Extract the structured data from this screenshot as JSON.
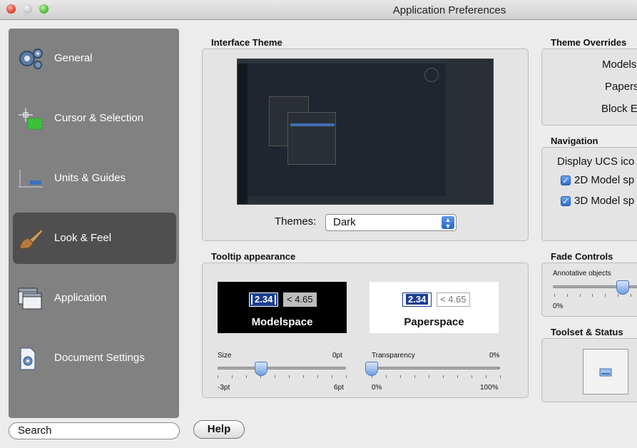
{
  "window": {
    "title": "Application Preferences"
  },
  "sidebar": {
    "items": [
      {
        "label": "General",
        "icon": "gear-icon"
      },
      {
        "label": "Cursor & Selection",
        "icon": "crosshair-cursor-icon"
      },
      {
        "label": "Units & Guides",
        "icon": "units-ruler-icon"
      },
      {
        "label": "Look & Feel",
        "icon": "paintbrush-icon",
        "selected": true
      },
      {
        "label": "Application",
        "icon": "application-windows-icon"
      },
      {
        "label": "Document Settings",
        "icon": "document-gear-icon"
      }
    ],
    "search_placeholder": "Search"
  },
  "help_label": "Help",
  "interface_theme": {
    "title": "Interface Theme",
    "themes_label": "Themes:",
    "selected": "Dark"
  },
  "tooltip": {
    "title": "Tooltip appearance",
    "model": {
      "caption": "Modelspace",
      "value1": "2.34",
      "value2": "< 4.65"
    },
    "paper": {
      "caption": "Paperspace",
      "value1": "2.34",
      "value2": "< 4.65"
    },
    "size": {
      "label": "Size",
      "value": "0pt",
      "min": "-3pt",
      "max": "6pt",
      "level": 0.34
    },
    "transparency": {
      "label": "Transparency",
      "value": "0%",
      "min": "0%",
      "max": "100%",
      "level": 0.0
    }
  },
  "theme_overrides": {
    "title": "Theme Overrides",
    "items": [
      "Models",
      "Papers",
      "Block E"
    ]
  },
  "navigation": {
    "title": "Navigation Controls",
    "display": "Display UCS ico",
    "cb1": "2D Model sp",
    "cb2": "3D Model sp"
  },
  "fade": {
    "title": "Fade Controls",
    "annotative": "Annotative objects",
    "min": "0%",
    "level": 0.6
  },
  "toolset": {
    "title": "Toolset & Status Ba"
  },
  "colors": {
    "sidebar": "#818181",
    "selection": "#4f4f4f",
    "accent": "#2466c9"
  }
}
